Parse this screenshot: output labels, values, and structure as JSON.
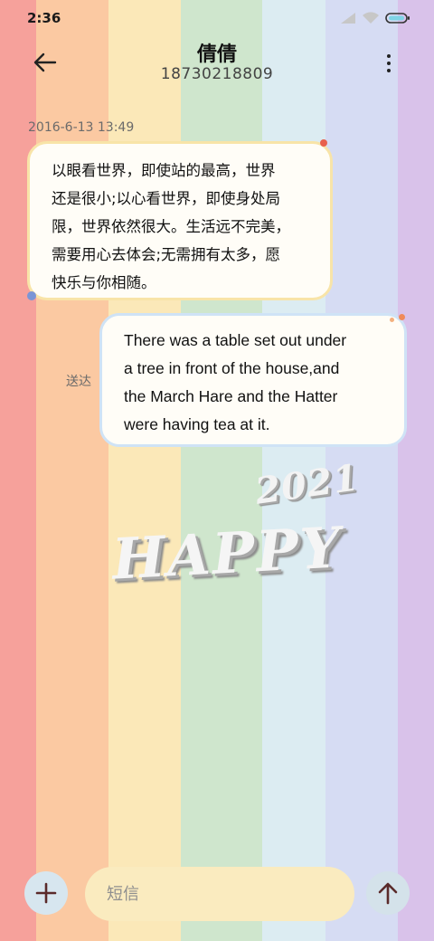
{
  "status_bar": {
    "time": "2:36"
  },
  "header": {
    "name": "倩倩",
    "number": "18730218809"
  },
  "conversation": {
    "timestamp": "2016-6-13 13:49",
    "incoming": {
      "lines": [
        "以眼看世界，即使站的最高，世界",
        "还是很小;以心看世界，即使身处局",
        "限，世界依然很大。生活远不完美，",
        "需要用心去体会;无需拥有太多，愿",
        "快乐与你相随。"
      ]
    },
    "outgoing": {
      "lines": [
        "There was a table set out under",
        "a tree in front of the house,and",
        "the March Hare and the Hatter",
        "were having tea at it."
      ],
      "status": "送达"
    }
  },
  "wallpaper": {
    "year": "2021",
    "greeting": "HAPPY"
  },
  "compose": {
    "placeholder": "短信"
  },
  "colors": {
    "stripes": [
      "#f6a19b",
      "#fbc9a2",
      "#fbe8b8",
      "#cfe6cd",
      "#dcecf2",
      "#d6dcf3",
      "#d9c2ea"
    ],
    "incoming_border": "#f8e4a8",
    "outgoing_border": "#cfe3f6",
    "input_bg": "#faebbf"
  },
  "icons": [
    "back-arrow-icon",
    "more-vertical-icon",
    "plus-icon",
    "send-arrow-icon",
    "signal-icon",
    "wifi-icon",
    "battery-icon"
  ]
}
